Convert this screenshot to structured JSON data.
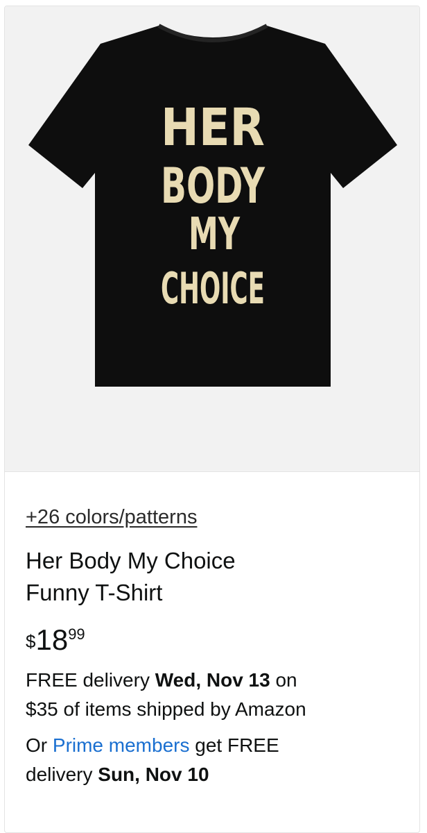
{
  "product": {
    "image_text": [
      "HER",
      "BODY",
      "MY",
      "CHOICE"
    ],
    "shirt_color": "#0e0e0e",
    "print_color": "#e8dbb3",
    "image_background": "#f2f2f2",
    "swatch_link": "+26 colors/patterns",
    "title_line1": "Her Body My Choice",
    "title_line2": "Funny T-Shirt",
    "price_symbol": "$",
    "price_whole": "18",
    "price_fraction": "99",
    "delivery": {
      "part1": "FREE delivery ",
      "date1": "Wed, Nov 13",
      "part2": " on",
      "line2": "$35 of items shipped by Amazon"
    },
    "prime": {
      "prefix": "Or ",
      "link": "Prime members",
      "suffix": " get FREE",
      "line2_prefix": "delivery ",
      "date2": "Sun, Nov 10"
    }
  }
}
